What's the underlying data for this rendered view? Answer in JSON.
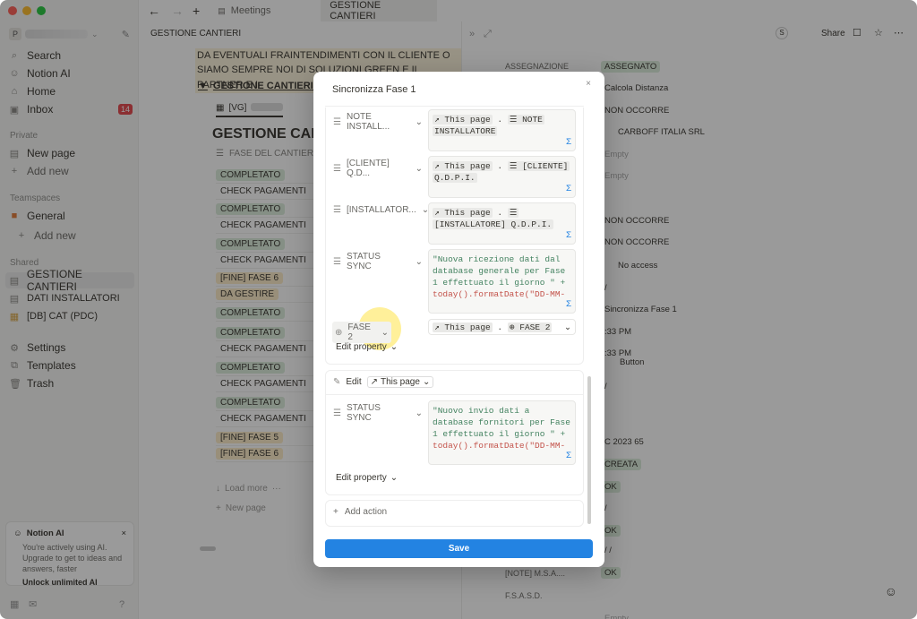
{
  "tabs": {
    "first": "Meetings",
    "second": "GESTIONE CANTIERI"
  },
  "sidebar": {
    "workspace_initial": "P",
    "search": "Search",
    "notion_ai": "Notion AI",
    "home": "Home",
    "inbox": "Inbox",
    "inbox_count": "14",
    "private_label": "Private",
    "new_page": "New page",
    "add_new": "Add new",
    "teamspaces_label": "Teamspaces",
    "general": "General",
    "add_new_2": "Add new",
    "shared_label": "Shared",
    "gestione_cantieri": "GESTIONE CANTIERI",
    "dati_installatori": "DATI INSTALLATORI",
    "db_cat": "[DB] CAT (PDC)",
    "settings": "Settings",
    "templates": "Templates",
    "trash": "Trash",
    "ai_card": {
      "title": "Notion AI",
      "body": "You're actively using AI. Upgrade to get to ideas and answers, faster",
      "cta": "Unlock unlimited AI"
    }
  },
  "main": {
    "breadcrumb": "GESTIONE CANTIERI",
    "banner_line1": "DA EVENTUALI FRAINTENDIMENTI CON IL CLIENTE O CON",
    "banner_line2": "SIAMO SEMPRE NOI DI SOLUZIONI GREEN E IL PARTNER E I",
    "toggle_title": "GESTIONE CANTIERI -",
    "view_tab": "[VG]",
    "db_title": "GESTIONE CANT",
    "column_header": "FASE DEL CANTIERE",
    "rows": [
      "COMPLETATO",
      "CHECK PAGAMENTI",
      "COMPLETATO",
      "CHECK PAGAMENTI",
      "COMPLETATO",
      "CHECK PAGAMENTI",
      "[FINE] FASE 6",
      "DA GESTIRE",
      "COMPLETATO",
      "COMPLETATO",
      "CHECK PAGAMENTI",
      "COMPLETATO",
      "CHECK PAGAMENTI",
      "COMPLETATO",
      "CHECK PAGAMENTI",
      "[FINE] FASE 5",
      "[FINE] FASE 6"
    ],
    "load_more": "Load more",
    "new_page": "New page"
  },
  "right": {
    "share": "Share",
    "avatar": "S",
    "assign_label": "ASSEGNAZIONE",
    "values": [
      "ASSEGNATO",
      "Calcola Distanza",
      "NON OCCORRE",
      "CARBOFF ITALIA SRL",
      "Empty",
      "Empty",
      "NON OCCORRE",
      "NON OCCORRE",
      "No access",
      "/",
      "Sincronizza Fase 1",
      ":33 PM",
      ":33 PM",
      "Button",
      "/",
      "C 2023 65",
      "CREATA",
      "OK",
      "/",
      "OK",
      "/ /",
      "OK",
      "Empty"
    ],
    "note_label": "[NOTE] M.S.A....",
    "fsasd_label": "F.S.A.S.D."
  },
  "modal": {
    "title": "Sincronizza Fase 1",
    "props": [
      {
        "name": "NOTE INSTALL...",
        "value_prefix": "This page",
        "value_tag": "NOTE",
        "value_rest": "INSTALLATORE"
      },
      {
        "name": "[CLIENTE] Q.D...",
        "value_prefix": "This page",
        "value_tag": "[CLIENTE]",
        "value_rest": "Q.D.P.I."
      },
      {
        "name": "[INSTALLATOR...",
        "value_prefix": "This page",
        "value_tag": "",
        "value_rest": "[INSTALLATORE] Q.D.P.I."
      },
      {
        "name": "STATUS SYNC",
        "line1": "\"Nuova ricezione dati dal",
        "line2": "database generale per Fase",
        "line3": "1 effettuato il giorno \" +",
        "line4": "today().formatDate(\"DD-MM-"
      },
      {
        "name": "FASE 2",
        "value_prefix": "This page",
        "value_tag": "FASE 2"
      }
    ],
    "edit_property": "Edit property",
    "edit": "Edit",
    "this_page": "This page",
    "status_sync_2": {
      "name": "STATUS SYNC",
      "line1": "\"Nuovo invio dati a",
      "line2": "database fornitori per Fase",
      "line3": "1 effettuato il giorno \" +",
      "line4": "today().formatDate(\"DD-MM-"
    },
    "edit_property_2": "Edit property",
    "add_action": "Add action",
    "save": "Save"
  },
  "colors": {
    "accent": "#2383e2",
    "green_pill": "#dbeddb",
    "yellow_pill": "#fdecc8"
  }
}
